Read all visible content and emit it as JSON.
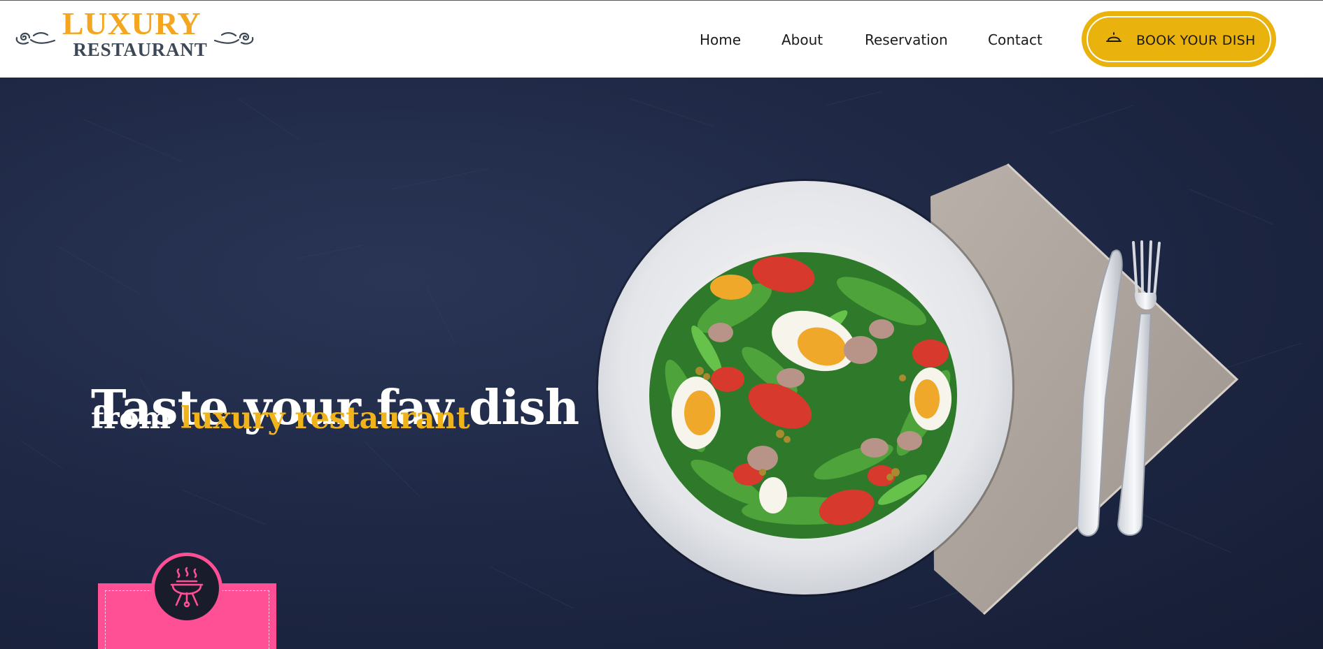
{
  "brand": {
    "name_top": "LUXURY",
    "name_bottom": "RESTAURANT",
    "logo_colors": {
      "top": "#f4a620",
      "bottom": "#3c4856"
    }
  },
  "nav": {
    "items": [
      {
        "label": "Home"
      },
      {
        "label": "About"
      },
      {
        "label": "Reservation"
      },
      {
        "label": "Contact"
      }
    ]
  },
  "cta": {
    "label": "BOOK YOUR DISH",
    "icon": "cloche-icon",
    "color": "#eab20d"
  },
  "hero": {
    "title": "Taste your fav dish",
    "subtitle_prefix": "from",
    "subtitle_highlight": "luxury restaurant",
    "highlight_color": "#f0b31b",
    "image": "salad-plate-with-fork-and-knife"
  },
  "badge": {
    "icon": "grill-icon",
    "color": "#ff4f95"
  }
}
